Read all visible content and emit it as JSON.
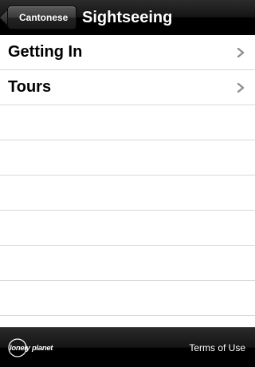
{
  "navbar": {
    "back_label": "Cantonese",
    "title": "Sightseeing"
  },
  "table": {
    "rows": [
      {
        "label": "Getting In"
      },
      {
        "label": "Tours"
      }
    ]
  },
  "toolbar": {
    "logo_text": "lonely planet",
    "terms_label": "Terms of Use"
  },
  "colors": {
    "bar_black": "#000000",
    "separator": "#d9d9d9",
    "chevron": "#8e8e93"
  }
}
